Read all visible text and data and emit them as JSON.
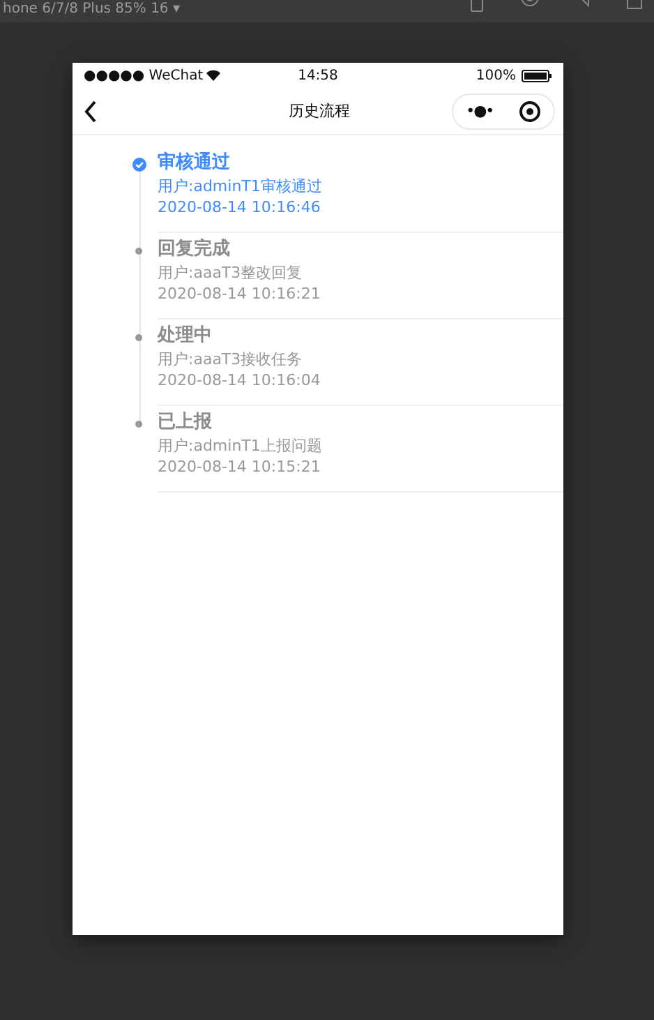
{
  "devtools": {
    "device_label": "hone 6/7/8 Plus 85% 16 ▾"
  },
  "status_bar": {
    "carrier": "●●●●● WeChat",
    "time": "14:58",
    "battery": "100%"
  },
  "nav": {
    "title": "历史流程",
    "menu": "•●•"
  },
  "timeline": [
    {
      "title": "审核通过",
      "detail": "用户:adminT1审核通过",
      "time": "2020-08-14 10:16:46",
      "active": true
    },
    {
      "title": "回复完成",
      "detail": "用户:aaaT3整改回复",
      "time": "2020-08-14 10:16:21",
      "active": false
    },
    {
      "title": "处理中",
      "detail": "用户:aaaT3接收任务",
      "time": "2020-08-14 10:16:04",
      "active": false
    },
    {
      "title": "已上报",
      "detail": "用户:adminT1上报问题",
      "time": "2020-08-14 10:15:21",
      "active": false
    }
  ]
}
